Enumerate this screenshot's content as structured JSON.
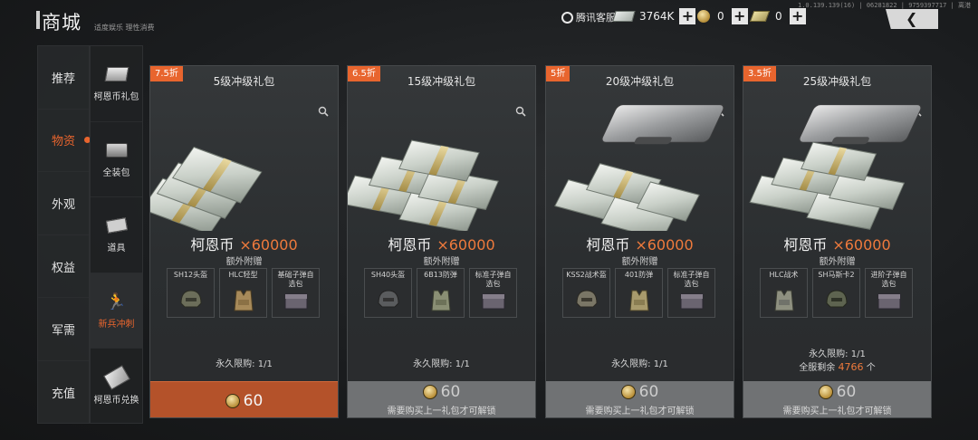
{
  "header": {
    "title": "商城",
    "subtitle": "适度娱乐 理性消费",
    "service_label": "腾讯客服",
    "currency_notes": "3764K",
    "currency_coins": "0",
    "currency_bills": "0",
    "plus_label": "+",
    "server_info": "1.0.139.139(16) | 06281822 | 9759397717 | 离港"
  },
  "left_nav": [
    {
      "label": "推荐"
    },
    {
      "label": "物资"
    },
    {
      "label": "外观"
    },
    {
      "label": "权益"
    },
    {
      "label": "军需"
    },
    {
      "label": "充值"
    }
  ],
  "sub_nav": [
    {
      "label": "柯恩币礼包",
      "icon": "banknote-stack-icon"
    },
    {
      "label": "全装包",
      "icon": "gear-case-icon"
    },
    {
      "label": "道具",
      "icon": "item-card-icon"
    },
    {
      "label": "新兵冲刺",
      "icon": "running-soldier-icon"
    },
    {
      "label": "柯恩币兑换",
      "icon": "banknote-exchange-icon"
    }
  ],
  "cards": [
    {
      "discount": "7.5折",
      "title": "5级冲级礼包",
      "reward_name": "柯恩币",
      "reward_qty": "×60000",
      "extra_label": "额外附赠",
      "items": [
        {
          "name": "SH12头盔"
        },
        {
          "name": "HLC轻型"
        },
        {
          "name": "基础子弹自选包"
        }
      ],
      "limit": "永久限购: 1/1",
      "price": "60",
      "state": "active"
    },
    {
      "discount": "6.5折",
      "title": "15级冲级礼包",
      "reward_name": "柯恩币",
      "reward_qty": "×60000",
      "extra_label": "额外附赠",
      "items": [
        {
          "name": "SH40头盔"
        },
        {
          "name": "6B13防弹"
        },
        {
          "name": "标准子弹自选包"
        }
      ],
      "limit": "永久限购: 1/1",
      "price": "60",
      "lock_note": "需要购买上一礼包才可解锁",
      "state": "locked"
    },
    {
      "discount": "5折",
      "title": "20级冲级礼包",
      "reward_name": "柯恩币",
      "reward_qty": "×60000",
      "extra_label": "额外附赠",
      "items": [
        {
          "name": "KSS2战术盔"
        },
        {
          "name": "401防弹"
        },
        {
          "name": "标准子弹自选包"
        }
      ],
      "limit": "永久限购: 1/1",
      "price": "60",
      "lock_note": "需要购买上一礼包才可解锁",
      "state": "locked"
    },
    {
      "discount": "3.5折",
      "title": "25级冲级礼包",
      "reward_name": "柯恩币",
      "reward_qty": "×60000",
      "extra_label": "额外附赠",
      "items": [
        {
          "name": "HLC战术"
        },
        {
          "name": "SH马斯卡2"
        },
        {
          "name": "进阶子弹自选包"
        }
      ],
      "limit": "永久限购: 1/1",
      "remain_label": "全服剩余",
      "remain_num": "4766",
      "remain_unit": "个",
      "price": "60",
      "lock_note": "需要购买上一礼包才可解锁",
      "state": "locked"
    }
  ],
  "colors": {
    "accent": "#e8652e",
    "buy_active": "#b4522a",
    "buy_locked": "#707274"
  }
}
